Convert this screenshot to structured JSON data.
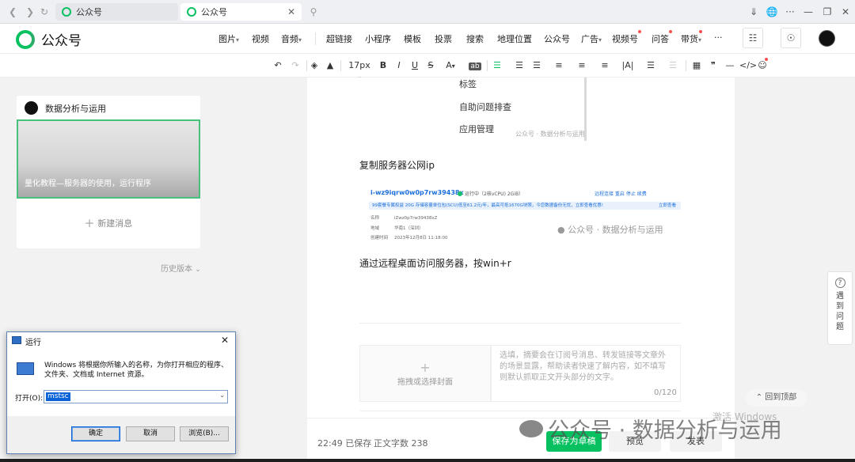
{
  "browser": {
    "tabs": [
      {
        "label": "公众号"
      },
      {
        "label": "公众号"
      }
    ]
  },
  "header": {
    "logo_text": "公众号",
    "insert_items": [
      {
        "label": "图片",
        "caret": "▾"
      },
      {
        "label": "视频",
        "caret": ""
      },
      {
        "label": "音频",
        "caret": "▾"
      },
      {
        "label": "超链接",
        "caret": ""
      },
      {
        "label": "小程序",
        "caret": ""
      },
      {
        "label": "模板",
        "caret": ""
      },
      {
        "label": "投票",
        "caret": ""
      },
      {
        "label": "搜索",
        "caret": ""
      },
      {
        "label": "地理位置",
        "caret": ""
      },
      {
        "label": "公众号",
        "caret": ""
      },
      {
        "label": "广告",
        "caret": "▾"
      },
      {
        "label": "视频号",
        "caret": ""
      },
      {
        "label": "问答",
        "caret": ""
      },
      {
        "label": "带货",
        "caret": "▾"
      }
    ],
    "more": "···"
  },
  "format_toolbar": {
    "font_size": "17px",
    "bold": "B",
    "italic": "I",
    "underline": "U",
    "strike": "S",
    "font_color": "A",
    "bg_color": "ab",
    "letter_spacing": "|A|",
    "quote": "❞",
    "code": "</>"
  },
  "left_panel": {
    "account_name": "数据分析与运用",
    "article_title": "量化教程—服务器的使用，运行程序",
    "new_message": "新建消息",
    "history": "历史版本"
  },
  "article": {
    "menu_items": [
      "标签",
      "自助问题排查",
      "应用管理"
    ],
    "img_watermark_small": "公众号 · 数据分析与运用",
    "paragraph1": "复制服务器公网ip",
    "server_shot": {
      "instance_id": "i-wz9iqrw0w0p7rw39438x",
      "status": "运行中（2核vCPU) 2GiB）",
      "links": "远程连接   重启   停止   续费",
      "band": "99套餐专属权益 20G 存储容量单位包(SCU)低至61.2元/年，最高可抵1670G块照，今您数据备份无忧，立即查看优惠!",
      "band_right": "立即查看",
      "rows": [
        {
          "k": "名称",
          "v": "iZwz0p7rw39438xZ"
        },
        {
          "k": "地域",
          "v": "华南1（深圳）"
        },
        {
          "k": "创建时间",
          "v": "2023年12月8日 11:18:00"
        }
      ]
    },
    "img_watermark_mid": "公众号 · 数据分析与运用",
    "paragraph2": "通过远程桌面访问服务器，按win+r",
    "cover_hint": "拖拽或选择封面",
    "summary_placeholder": "选填，摘要会在订阅号消息、转发链接等文章外的场景显露，帮助读者快速了解内容，如不填写则默认抓取正文开头部分的文字。",
    "summary_count": "0/120"
  },
  "bottom_bar": {
    "save_time": "22:49 已保存",
    "word_count": "正文字数 238",
    "save_draft": "保存为草稿",
    "preview": "预览",
    "publish": "发表"
  },
  "side": {
    "help_label": "遇到问题",
    "back_to_top": "回到顶部"
  },
  "overlay": {
    "watermark": "公众号 · 数据分析与运用",
    "activate": "激活 Windows"
  },
  "run_dialog": {
    "title": "运行",
    "description": "Windows 将根据你所输入的名称，为你打开相应的程序、文件夹、文档或 Internet 资源。",
    "open_label": "打开(O):",
    "input_value": "mstsc",
    "ok": "确定",
    "cancel": "取消",
    "browse": "浏览(B)..."
  },
  "colors": {
    "brand_green": "#07c160",
    "selection_blue": "#0a64d8",
    "badge_red": "#fa5151"
  }
}
